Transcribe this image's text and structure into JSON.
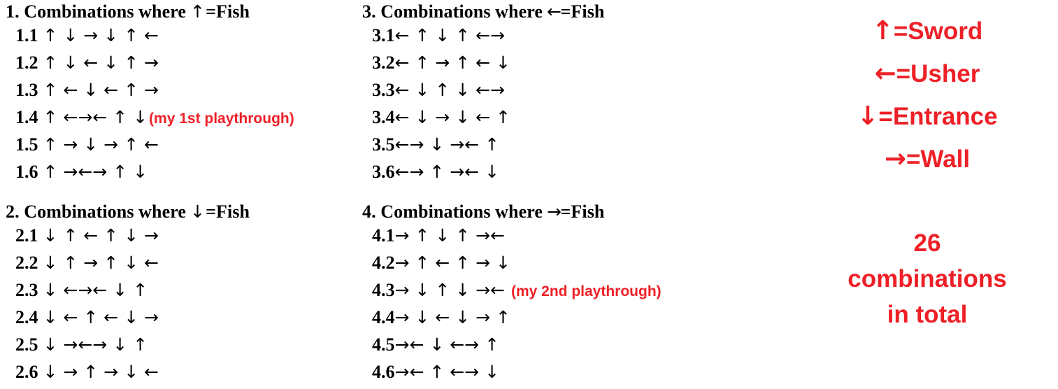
{
  "colors": {
    "text": "#000000",
    "accent_red": "#ee2027",
    "background": "#ffffff"
  },
  "sections": [
    {
      "id": "section-1",
      "header_prefix": "1. Combinations where",
      "header_arrow": "↑",
      "header_suffix": "=Fish",
      "rows": [
        {
          "label": "1.1",
          "sequence": "↑ ↓ → ↓ ↑ ←",
          "note": ""
        },
        {
          "label": "1.2",
          "sequence": "↑ ↓ ← ↓ ↑ →",
          "note": ""
        },
        {
          "label": "1.3",
          "sequence": "↑ ← ↓ ← ↑ →",
          "note": ""
        },
        {
          "label": "1.4",
          "sequence": "↑ ←→← ↑ ↓",
          "note": "(my 1st playthrough)"
        },
        {
          "label": "1.5",
          "sequence": "↑ → ↓ → ↑ ←",
          "note": ""
        },
        {
          "label": "1.6",
          "sequence": "↑ →←→ ↑ ↓",
          "note": ""
        }
      ]
    },
    {
      "id": "section-2",
      "header_prefix": "2. Combinations where",
      "header_arrow": "↓",
      "header_suffix": "=Fish",
      "rows": [
        {
          "label": "2.1",
          "sequence": "↓ ↑ ← ↑ ↓ →",
          "note": ""
        },
        {
          "label": "2.2",
          "sequence": "↓ ↑ → ↑ ↓ ←",
          "note": ""
        },
        {
          "label": "2.3",
          "sequence": "↓ ←→← ↓ ↑",
          "note": ""
        },
        {
          "label": "2.4",
          "sequence": "↓ ← ↑ ← ↓ →",
          "note": ""
        },
        {
          "label": "2.5",
          "sequence": "↓ →←→ ↓ ↑",
          "note": ""
        },
        {
          "label": "2.6",
          "sequence": "↓ → ↑ → ↓ ←",
          "note": ""
        }
      ]
    },
    {
      "id": "section-3",
      "header_prefix": "3. Combinations where",
      "header_arrow": "←",
      "header_suffix": "=Fish",
      "rows": [
        {
          "label": "3.1",
          "sequence": "← ↑ ↓ ↑ ←→",
          "note": ""
        },
        {
          "label": "3.2",
          "sequence": "← ↑ → ↑ ← ↓",
          "note": ""
        },
        {
          "label": "3.3",
          "sequence": "← ↓ ↑ ↓ ←→",
          "note": ""
        },
        {
          "label": "3.4",
          "sequence": "← ↓ → ↓ ← ↑",
          "note": ""
        },
        {
          "label": "3.5",
          "sequence": "←→ ↓ →← ↑",
          "note": ""
        },
        {
          "label": "3.6",
          "sequence": "←→ ↑ →← ↓",
          "note": ""
        }
      ]
    },
    {
      "id": "section-4",
      "header_prefix": "4. Combinations where",
      "header_arrow": "→",
      "header_suffix": "=Fish",
      "rows": [
        {
          "label": "4.1",
          "sequence": "→ ↑ ↓ ↑ →←",
          "note": ""
        },
        {
          "label": "4.2",
          "sequence": "→ ↑ ← ↑ → ↓",
          "note": ""
        },
        {
          "label": "4.3",
          "sequence": "→ ↓ ↑ ↓ →←",
          "note": "(my 2nd playthrough)"
        },
        {
          "label": "4.4",
          "sequence": "→ ↓ ← ↓ → ↑",
          "note": ""
        },
        {
          "label": "4.5",
          "sequence": "→← ↓ ←→ ↑",
          "note": ""
        },
        {
          "label": "4.6",
          "sequence": "→← ↑ ←→ ↓",
          "note": ""
        }
      ]
    }
  ],
  "legend": {
    "items": [
      {
        "arrow": "↑",
        "label": "=Sword"
      },
      {
        "arrow": "←",
        "label": "=Usher"
      },
      {
        "arrow": "↓",
        "label": "=Entrance"
      },
      {
        "arrow": "→",
        "label": "=Wall"
      }
    ]
  },
  "total": {
    "line1": "26",
    "line2": "combinations",
    "line3": "in total"
  }
}
